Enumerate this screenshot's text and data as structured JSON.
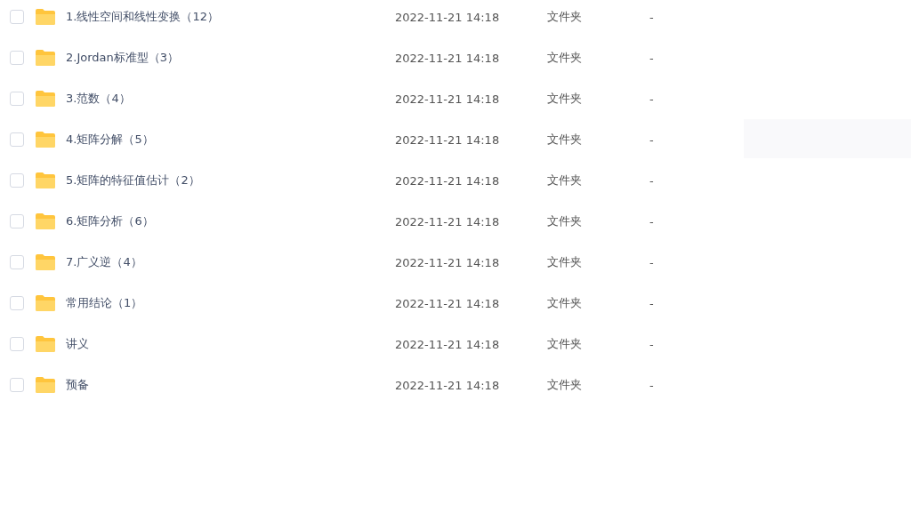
{
  "files": [
    {
      "name": "1.线性空间和线性变换（12）",
      "modified": "2022-11-21 14:18",
      "type": "文件夹",
      "size": "-",
      "checked": false
    },
    {
      "name": "2.Jordan标准型（3）",
      "modified": "2022-11-21 14:18",
      "type": "文件夹",
      "size": "-",
      "checked": false
    },
    {
      "name": "3.范数（4）",
      "modified": "2022-11-21 14:18",
      "type": "文件夹",
      "size": "-",
      "checked": false
    },
    {
      "name": "4.矩阵分解（5）",
      "modified": "2022-11-21 14:18",
      "type": "文件夹",
      "size": "-",
      "checked": false
    },
    {
      "name": "5.矩阵的特征值估计（2）",
      "modified": "2022-11-21 14:18",
      "type": "文件夹",
      "size": "-",
      "checked": false
    },
    {
      "name": "6.矩阵分析（6）",
      "modified": "2022-11-21 14:18",
      "type": "文件夹",
      "size": "-",
      "checked": false
    },
    {
      "name": "7.广义逆（4）",
      "modified": "2022-11-21 14:18",
      "type": "文件夹",
      "size": "-",
      "checked": false
    },
    {
      "name": "常用结论（1）",
      "modified": "2022-11-21 14:18",
      "type": "文件夹",
      "size": "-",
      "checked": false
    },
    {
      "name": "讲义",
      "modified": "2022-11-21 14:18",
      "type": "文件夹",
      "size": "-",
      "checked": false
    },
    {
      "name": "预备",
      "modified": "2022-11-21 14:18",
      "type": "文件夹",
      "size": "-",
      "checked": false
    }
  ]
}
